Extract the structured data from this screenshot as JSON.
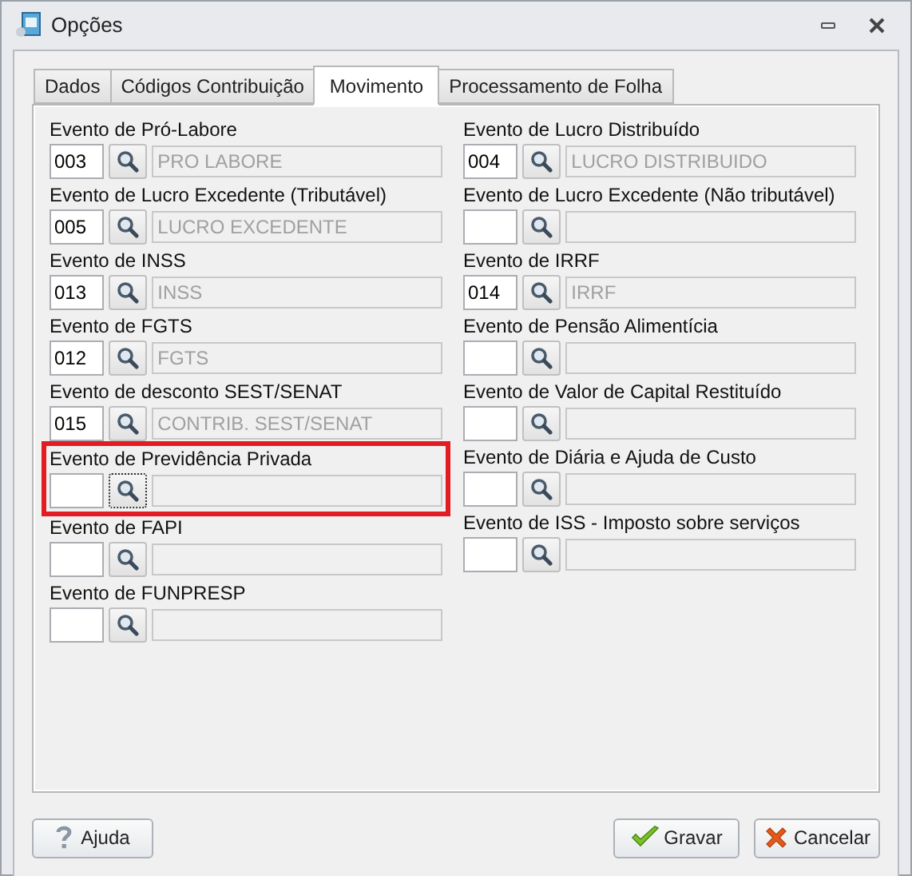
{
  "window": {
    "title": "Opções"
  },
  "tabs": [
    {
      "label": "Dados",
      "selected": false
    },
    {
      "label": "Códigos Contribuição",
      "selected": false
    },
    {
      "label": "Movimento",
      "selected": true
    },
    {
      "label": "Processamento de Folha",
      "selected": false
    }
  ],
  "columns": [
    [
      {
        "label": "Evento de Pró-Labore",
        "code": "003",
        "description": "PRO LABORE",
        "highlighted": false
      },
      {
        "label": "Evento de Lucro Excedente (Tributável)",
        "code": "005",
        "description": "LUCRO EXCEDENTE",
        "highlighted": false
      },
      {
        "label": "Evento de INSS",
        "code": "013",
        "description": "INSS",
        "highlighted": false
      },
      {
        "label": "Evento de FGTS",
        "code": "012",
        "description": "FGTS",
        "highlighted": false
      },
      {
        "label": "Evento de desconto SEST/SENAT",
        "code": "015",
        "description": "CONTRIB. SEST/SENAT",
        "highlighted": false
      },
      {
        "label": "Evento de Previdência Privada",
        "highlighted": true
      },
      {
        "label": "Evento de FAPI",
        "highlighted": false
      },
      {
        "label": "Evento de FUNPRESP",
        "highlighted": false
      }
    ],
    [
      {
        "label": "Evento de Lucro Distribuído",
        "code": "004",
        "description": "LUCRO DISTRIBUIDO",
        "highlighted": false
      },
      {
        "label": "Evento de Lucro Excedente (Não tributável)",
        "highlighted": false
      },
      {
        "label": "Evento de IRRF",
        "code": "014",
        "description": "IRRF",
        "highlighted": false
      },
      {
        "label": "Evento de Pensão Alimentícia",
        "highlighted": false
      },
      {
        "label": "Evento de Valor de Capital Restituído",
        "highlighted": false
      },
      {
        "label": "Evento de Diária e Ajuda de Custo",
        "highlighted": false
      },
      {
        "label": "Evento de ISS - Imposto sobre serviços",
        "highlighted": false
      }
    ]
  ],
  "buttons": [
    {
      "label": "Ajuda",
      "kind": "help"
    },
    {
      "label": "Gravar",
      "kind": "save"
    },
    {
      "label": "Cancelar",
      "kind": "cancel"
    }
  ]
}
